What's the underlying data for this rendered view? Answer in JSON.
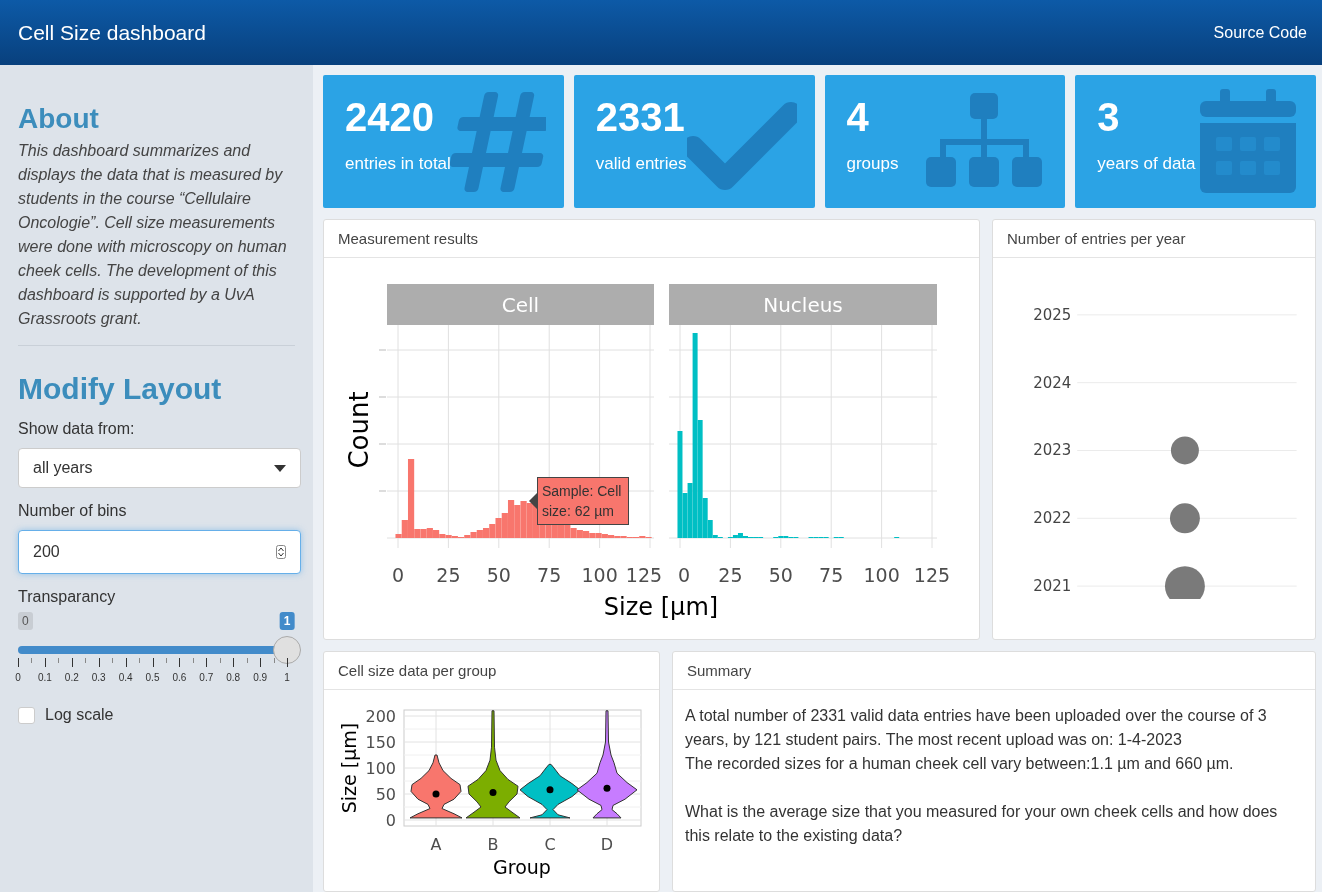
{
  "header": {
    "title": "Cell Size dashboard",
    "link": "Source Code"
  },
  "sidebar": {
    "about": {
      "heading": "About",
      "text": "This dashboard summarizes and displays the data that is measured by students in the course “Cellulaire Oncologie”. Cell size measurements were done with microscopy on human cheek cells. The development of this dashboard is supported by a UvA Grassroots grant."
    },
    "layout": {
      "heading": "Modify Layout",
      "show_data": {
        "label": "Show data from:",
        "value": "all years"
      },
      "bins": {
        "label": "Number of bins",
        "value": "200"
      },
      "transparancy": {
        "label": "Transparancy",
        "min": "0",
        "value_label": "1",
        "level": 1,
        "ticks": [
          "0",
          "0.1",
          "0.2",
          "0.3",
          "0.4",
          "0.5",
          "0.6",
          "0.7",
          "0.8",
          "0.9",
          "1"
        ]
      },
      "log_scale": {
        "label": "Log scale",
        "checked": false
      }
    }
  },
  "value_boxes": [
    {
      "value": "2420",
      "label": "entries in total",
      "kind": "hash"
    },
    {
      "value": "2331",
      "label": "valid entries",
      "kind": "check"
    },
    {
      "value": "4",
      "label": "groups",
      "kind": "sitemap"
    },
    {
      "value": "3",
      "label": "years of data",
      "kind": "calendar"
    }
  ],
  "measurement": {
    "title": "Measurement results",
    "facets": [
      {
        "label": "Cell",
        "x_ticks": [
          "0",
          "25",
          "50",
          "75",
          "100",
          "125"
        ]
      },
      {
        "label": "Nucleus",
        "x_ticks": [
          "0",
          "25",
          "50",
          "75",
          "100",
          "125"
        ]
      }
    ],
    "y_label": "Count",
    "x_label": "Size [µm]",
    "tooltip": [
      "Sample: Cell",
      "size: 62 µm"
    ]
  },
  "years": {
    "title": "Number of entries per year",
    "rows": [
      {
        "year": "2025",
        "kind": "none"
      },
      {
        "year": "2024",
        "kind": "none"
      },
      {
        "year": "2023",
        "kind": "small"
      },
      {
        "year": "2022",
        "kind": "medium"
      },
      {
        "year": "2021",
        "kind": "large"
      }
    ]
  },
  "group_chart": {
    "title": "Cell size data per group",
    "y_label": "Size [µm]",
    "x_label": "Group",
    "y_ticks": [
      "200",
      "150",
      "100",
      "50",
      "0"
    ],
    "groups": [
      {
        "name": "A",
        "color": "#f8766d"
      },
      {
        "name": "B",
        "color": "#7cae00"
      },
      {
        "name": "C",
        "color": "#00bfc4"
      },
      {
        "name": "D",
        "color": "#c77cff"
      }
    ]
  },
  "summary": {
    "title": "Summary",
    "lines": [
      "A total number of 2331 valid data entries have been uploaded over the course of 3 years, by 121 student pairs. The most recent upload was on: 1-4-2023",
      "The recorded sizes for a human cheek cell vary between:1.1 µm and 660 µm."
    ],
    "question": "What is the average size that you measured for your own cheek cells and how does this relate to the existing data?"
  }
}
